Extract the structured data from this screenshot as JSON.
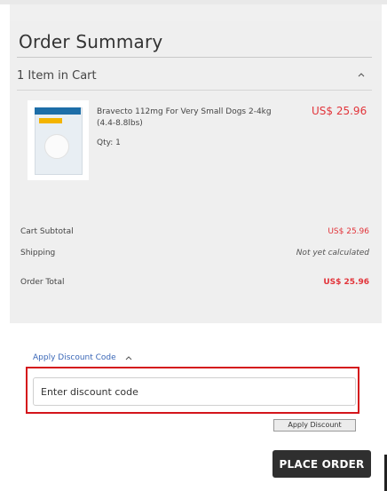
{
  "summary": {
    "title": "Order Summary",
    "cart_count": "1 Item in Cart",
    "item": {
      "name": "Bravecto 112mg For Very Small Dogs 2-4kg (4.4-8.8lbs)",
      "price": "US$ 25.96",
      "qty": "Qty: 1"
    },
    "totals": {
      "subtotal_label": "Cart Subtotal",
      "subtotal_value": "US$ 25.96",
      "shipping_label": "Shipping",
      "shipping_value": "Not yet calculated",
      "order_total_label": "Order Total",
      "order_total_value": "US$ 25.96"
    }
  },
  "discount": {
    "toggle_label": "Apply Discount Code",
    "placeholder": "Enter discount code",
    "apply_label": "Apply Discount"
  },
  "checkout": {
    "place_order_label": "PLACE ORDER"
  },
  "colors": {
    "price": "#e2343a",
    "link": "#3a67b7",
    "highlight": "#d4151b",
    "primary_button": "#2f2f2f"
  },
  "icons": {
    "cart_toggle": "chevron-up-icon",
    "discount_toggle": "chevron-up-icon"
  }
}
